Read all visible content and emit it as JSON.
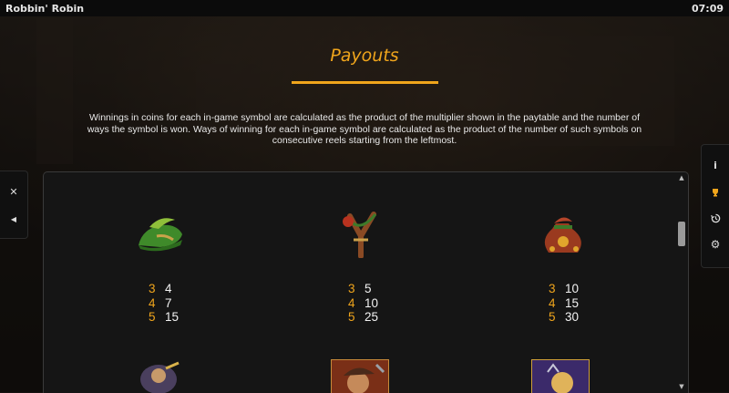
{
  "window": {
    "title": "Robbin' Robin",
    "time": "07:09"
  },
  "page": {
    "heading": "Payouts",
    "description": "Winnings in coins for each in-game symbol are calculated as the product of the multiplier shown in the paytable and the number of ways the symbol is won. Ways of winning for each in-game symbol are calculated as the product of the number of such symbols on consecutive reels starting from the leftmost."
  },
  "left_controls": {
    "close_icon": "close-icon",
    "back_icon": "triangle-left-icon"
  },
  "right_controls": {
    "icons": [
      "info-icon",
      "trophy-icon",
      "history-icon",
      "gear-icon"
    ]
  },
  "symbols": [
    {
      "name": "green-feather-hat",
      "payouts": [
        {
          "count": "3",
          "mult": "4"
        },
        {
          "count": "4",
          "mult": "7"
        },
        {
          "count": "5",
          "mult": "15"
        }
      ]
    },
    {
      "name": "slingshot",
      "payouts": [
        {
          "count": "3",
          "mult": "5"
        },
        {
          "count": "4",
          "mult": "10"
        },
        {
          "count": "5",
          "mult": "25"
        }
      ]
    },
    {
      "name": "coin-sack",
      "payouts": [
        {
          "count": "3",
          "mult": "10"
        },
        {
          "count": "4",
          "mult": "15"
        },
        {
          "count": "5",
          "mult": "30"
        }
      ]
    }
  ],
  "colors": {
    "accent": "#f0a51c",
    "panel": "#151515",
    "topbar": "#0b0b0b"
  }
}
